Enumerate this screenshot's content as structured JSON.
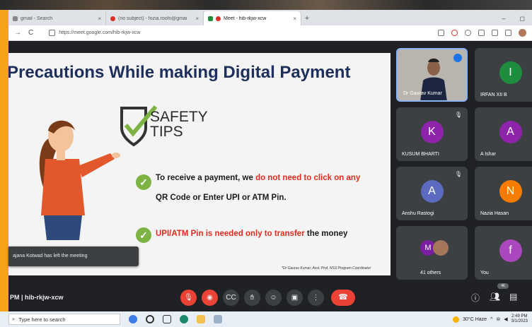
{
  "browser": {
    "tabs": [
      {
        "label": "gmail - Search",
        "icon": "google-icon",
        "active": false
      },
      {
        "label": "(no subject) - fozia.roohi@gmai",
        "icon": "gmail-icon",
        "active": false
      },
      {
        "label": "Meet - hib-rkjw-xcw",
        "icon": "meet-icon",
        "active": true
      }
    ],
    "url": "https://meet.google.com/hib-rkjw-xcw",
    "new_tab": "+",
    "window_controls": [
      "–",
      "◻"
    ]
  },
  "slide": {
    "title": "Precautions While making Digital Payment",
    "badge_line1": "SAFETY",
    "badge_line2": "TIPS",
    "point1_a": "To receive a payment, we",
    "point1_b": "do not need to click on any",
    "point1_c": "QR Code or Enter UPI or ATM Pin",
    "point1_d": ".",
    "point2_a": "UPI/ATM Pin is needed only to transfer",
    "point2_b": "the money",
    "credit": "*Dr Gaurav Kumar, Asst. Prof, NSS Program Coordinator",
    "colors": {
      "title": "#1d2f5a",
      "highlight": "#e02b1f",
      "check": "#7cb342"
    }
  },
  "toast": "ajana Kotwad has left the meeting",
  "participants": [
    {
      "name": "Dr Gaurav Kumar",
      "initial": "",
      "color": "#b9b4ad",
      "speaking": true
    },
    {
      "name": "IRFAN XII B",
      "initial": "I",
      "color": "#1e8e3e"
    },
    {
      "name": "KUSUM BHARTI",
      "initial": "K",
      "color": "#8e24aa"
    },
    {
      "name": "A Ishar",
      "initial": "A",
      "color": "#8e24aa"
    },
    {
      "name": "Anshu Rastogi",
      "initial": "A",
      "color": "#5c6bc0"
    },
    {
      "name": "Nazia Hasan",
      "initial": "N",
      "color": "#f57c00"
    },
    {
      "name": "41 others",
      "initial": "M",
      "color": "#7b1fa2"
    },
    {
      "name": "You",
      "initial": "f",
      "color": "#ab47bc"
    }
  ],
  "meeting": {
    "code": "PM  |  hib-rkjw-xcw",
    "people_badge": "46",
    "controls": [
      "mic-off",
      "camera-off",
      "captions",
      "raise-hand",
      "emoji",
      "present",
      "more",
      "hang-up"
    ]
  },
  "taskbar": {
    "search_placeholder": "Type here to search",
    "weather": "30°C  Haze",
    "time": "2:49 PM",
    "date": "3/1/2023"
  }
}
